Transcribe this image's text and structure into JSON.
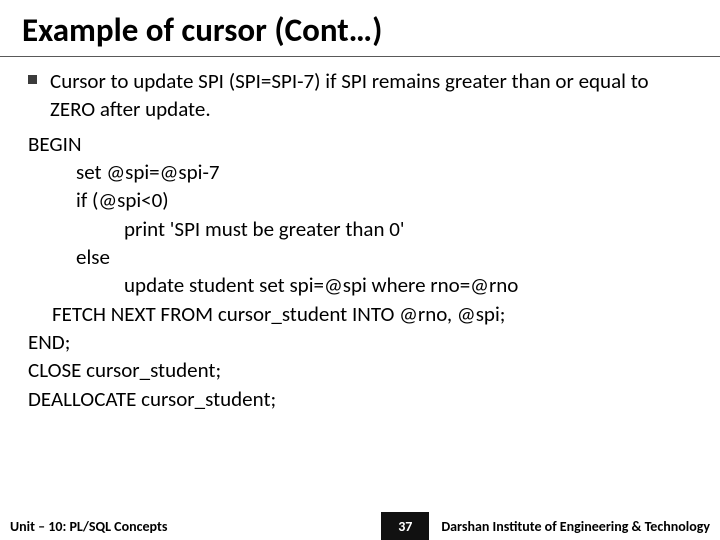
{
  "title": "Example of cursor (Cont…)",
  "bullet_text": "Cursor to update SPI (SPI=SPI-7) if SPI remains greater than or equal to ZERO after update.",
  "code": {
    "l1": "BEGIN",
    "l2": "set @spi=@spi-7",
    "l3": "if (@spi<0)",
    "l4": "print 'SPI must be greater than 0'",
    "l5": "else",
    "l6": "update student set spi=@spi where rno=@rno",
    "l7": "FETCH NEXT FROM cursor_student INTO @rno, @spi;",
    "l8": "END;",
    "l9": "CLOSE cursor_student;",
    "l10": "DEALLOCATE cursor_student;"
  },
  "footer": {
    "left": "Unit – 10: PL/SQL Concepts",
    "page": "37",
    "right": "Darshan Institute of Engineering & Technology"
  }
}
